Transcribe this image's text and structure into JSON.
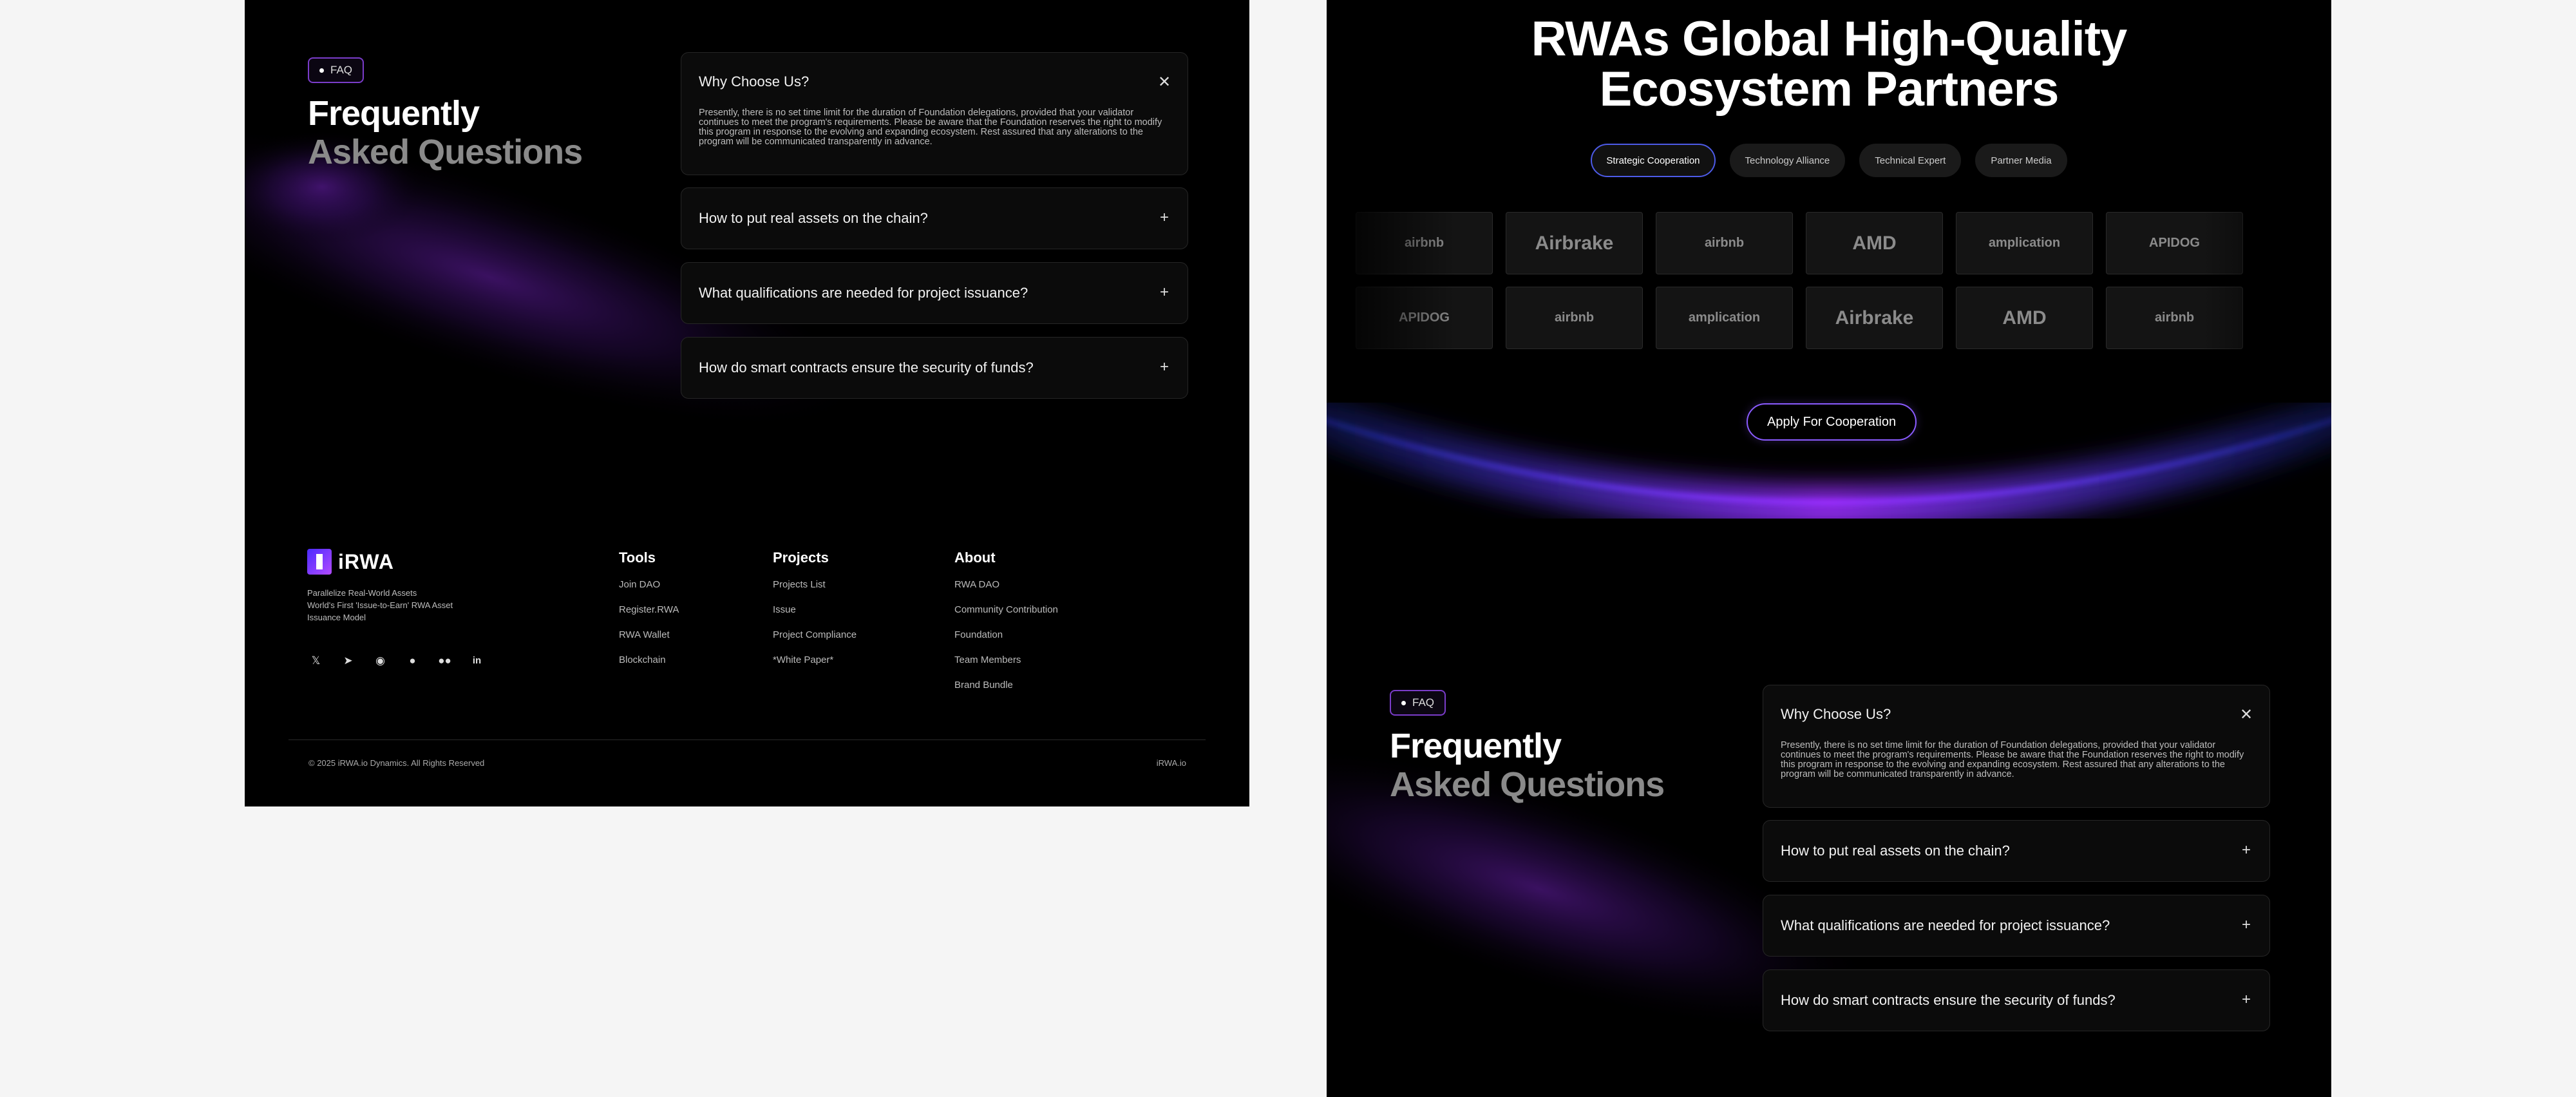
{
  "faq": {
    "badge": "FAQ",
    "title_line1": "Frequently",
    "title_line2": "Asked Questions",
    "items": [
      {
        "question": "Why Choose Us?",
        "answer": "Presently, there is no set time limit for the duration of Foundation delegations, provided that your validator continues to meet the program's requirements. Please be aware that the Foundation reserves the right to modify this program in response to the evolving and expanding ecosystem. Rest assured that any alterations to the program will be communicated transparently in advance.",
        "icon": "close-icon"
      },
      {
        "question": "How to put real assets on the chain?",
        "icon": "plus-icon"
      },
      {
        "question": "What qualifications are needed for project issuance?",
        "icon": "plus-icon"
      },
      {
        "question": "How do smart contracts ensure the security of funds?",
        "icon": "plus-icon"
      }
    ]
  },
  "footer": {
    "logo_text": "iRWA",
    "tagline": [
      "Parallelize Real-World Assets",
      "World's First 'Issue-to-Earn' RWA Asset Issuance Model"
    ],
    "socials": [
      "x-icon",
      "telegram-icon",
      "discord-icon",
      "github-icon",
      "medium-icon",
      "linkedin-icon"
    ],
    "columns": [
      {
        "title": "Tools",
        "links": [
          "Join DAO",
          "Register.RWA",
          "RWA Wallet",
          "Blockchain"
        ]
      },
      {
        "title": "Projects",
        "links": [
          "Projects List",
          "Issue",
          "Project Compliance",
          "*White Paper*"
        ]
      },
      {
        "title": "About",
        "links": [
          "RWA DAO",
          "Community Contribution",
          "Foundation",
          "Team Members",
          "Brand Bundle"
        ]
      }
    ],
    "copyright": "© 2025 iRWA.io Dynamics. All Rights Reserved",
    "domain": "iRWA.io"
  },
  "partners": {
    "title_line1": "RWAs Global High-Quality",
    "title_line2": "Ecosystem Partners",
    "tabs": [
      {
        "label": "Strategic Cooperation",
        "active": true
      },
      {
        "label": "Technology Alliance",
        "active": false
      },
      {
        "label": "Technical Expert",
        "active": false
      },
      {
        "label": "Partner Media",
        "active": false
      }
    ],
    "row1": [
      "airbnb",
      "Airbrake",
      "airbnb",
      "AMD",
      "amplication",
      "APIDOG"
    ],
    "row2": [
      "APIDOG",
      "airbnb",
      "amplication",
      "Airbrake",
      "AMD",
      "airbnb"
    ],
    "apply_label": "Apply For Cooperation"
  },
  "colors": {
    "accent": "#7a3cc9",
    "tab_active_border": "#4d5be8",
    "apply_border": "#8a5bff"
  }
}
